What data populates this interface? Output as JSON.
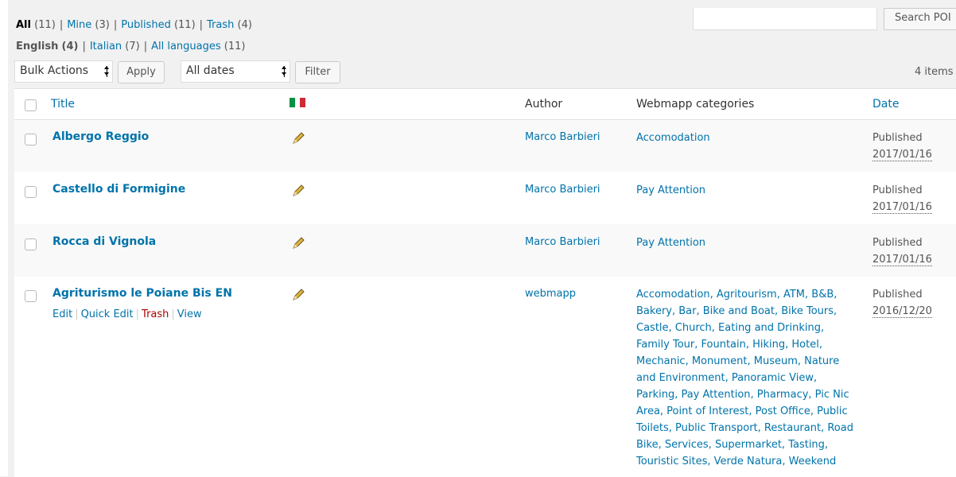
{
  "status_filters": [
    {
      "label": "All",
      "count": "(11)",
      "current": true
    },
    {
      "label": "Mine",
      "count": "(3)"
    },
    {
      "label": "Published",
      "count": "(11)"
    },
    {
      "label": "Trash",
      "count": "(4)"
    }
  ],
  "language_filters": [
    {
      "label": "English",
      "count": "(4)",
      "current": true
    },
    {
      "label": "Italian",
      "count": "(7)"
    },
    {
      "label": "All languages",
      "count": "(11)"
    }
  ],
  "search": {
    "value": "",
    "button": "Search POI"
  },
  "bulk_actions": {
    "selected": "Bulk Actions",
    "apply": "Apply"
  },
  "date_filter": {
    "selected": "All dates",
    "filter": "Filter"
  },
  "items_count": "4 items",
  "columns": {
    "title": "Title",
    "author": "Author",
    "categories": "Webmapp categories",
    "date": "Date"
  },
  "flag_colors": [
    "#009246",
    "#ffffff",
    "#ce2b37"
  ],
  "rows": [
    {
      "title": "Albergo Reggio",
      "author": "Marco Barbieri",
      "categories": "Accomodation",
      "status": "Published",
      "date": "2017/01/16"
    },
    {
      "title": "Castello di Formigine",
      "author": "Marco Barbieri",
      "categories": "Pay Attention",
      "status": "Published",
      "date": "2017/01/16"
    },
    {
      "title": "Rocca di Vignola",
      "author": "Marco Barbieri",
      "categories": "Pay Attention",
      "status": "Published",
      "date": "2017/01/16"
    },
    {
      "title": "Agriturismo le Poiane Bis EN",
      "author": "webmapp",
      "categories": "Accomodation, Agritourism, ATM, B&B, Bakery, Bar, Bike and Boat, Bike Tours, Castle, Church, Eating and Drinking, Family Tour, Fountain, Hiking, Hotel, Mechanic, Monument, Museum, Nature and Environment, Panoramic View, Parking, Pay Attention, Pharmacy, Pic Nic Area, Point of Interest, Post Office, Public Toilets, Public Transport, Restaurant, Road Bike, Services, Supermarket, Tasting, Touristic Sites, Verde Natura, Weekend",
      "status": "Published",
      "date": "2016/12/20"
    }
  ],
  "row_actions": {
    "edit": "Edit",
    "quick_edit": "Quick Edit",
    "trash": "Trash",
    "view": "View"
  }
}
